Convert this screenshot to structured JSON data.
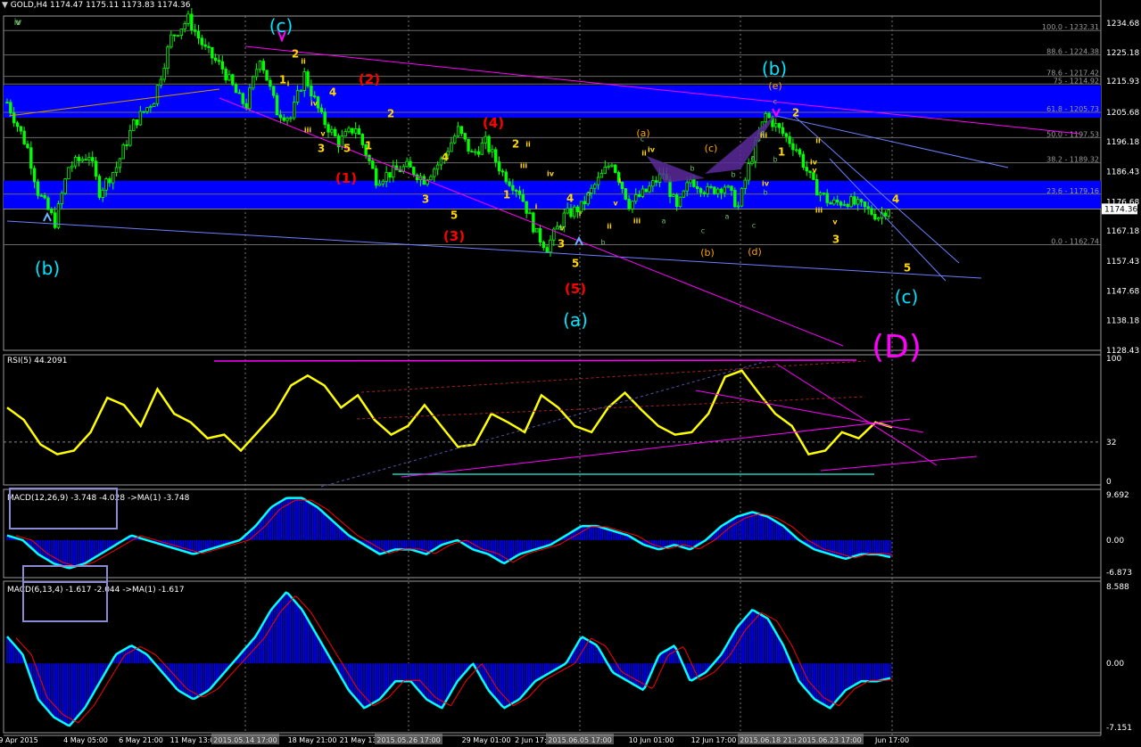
{
  "window": {
    "title": "GOLD,H4",
    "ohlc": "1174.47 1175.11 1173.83 1174.36"
  },
  "colors": {
    "background": "#000000",
    "bullCandle": "#00ff00",
    "bearCandle": "#00cc00",
    "zone": "#0000ff",
    "fib": "#6a6a6a",
    "magentaLine": "#ff00ff",
    "rsiLine": "#ffff00",
    "macdHist": "#0000ff",
    "macdMain": "#00ffff",
    "macdSignal": "#ff0000",
    "waveCyan": "#00e5ff",
    "waveRed": "#ff0000",
    "waveOrange": "#ffa500",
    "waveYellow": "#ffd700",
    "waveGreen": "#6fbf6f",
    "pinkD": "#ff00ff"
  },
  "chart_data": [
    {
      "type": "candlestick",
      "panel": "price",
      "symbol": "GOLD",
      "timeframe": "H4",
      "ylim": [
        1128.43,
        1237.0
      ],
      "yticks": [
        "1234.68",
        "1225.18",
        "1215.93",
        "1205.68",
        "1196.18",
        "1186.43",
        "1176.68",
        "1167.18",
        "1157.43",
        "1147.68",
        "1138.18",
        "1128.43"
      ],
      "current_price": "1174.36",
      "x_labels": [
        "29 Apr 2015",
        "4 May 05:00",
        "6 May 21:00",
        "11 May 13:00",
        "2015.05.14 17:00",
        "18 May 21:00",
        "21 May 13:00",
        "2015.05.26 17:00",
        "29 May 01:00",
        "2 Jun 17:00",
        "2015.06.05 17:00",
        "10 Jun 01:00",
        "12 Jun 17:00",
        "2015.06.18 21:00",
        "2015.06.23 17:00",
        "Jun 17:00"
      ],
      "path_points": [
        [
          0,
          1209
        ],
        [
          6,
          1194
        ],
        [
          9,
          1180
        ],
        [
          14,
          1170
        ],
        [
          18,
          1188
        ],
        [
          24,
          1192
        ],
        [
          27,
          1180
        ],
        [
          32,
          1188
        ],
        [
          37,
          1202
        ],
        [
          43,
          1210
        ],
        [
          48,
          1230
        ],
        [
          53,
          1236
        ],
        [
          58,
          1226
        ],
        [
          63,
          1220
        ],
        [
          68,
          1210
        ],
        [
          70,
          1208
        ],
        [
          74,
          1224
        ],
        [
          79,
          1206
        ],
        [
          83,
          1204
        ],
        [
          87,
          1218
        ],
        [
          92,
          1204
        ],
        [
          97,
          1196
        ],
        [
          102,
          1201
        ],
        [
          108,
          1184
        ],
        [
          112,
          1186
        ],
        [
          117,
          1188
        ],
        [
          122,
          1184
        ],
        [
          127,
          1190
        ],
        [
          132,
          1200
        ],
        [
          136,
          1192
        ],
        [
          140,
          1196
        ],
        [
          145,
          1186
        ],
        [
          150,
          1180
        ],
        [
          155,
          1166
        ],
        [
          158,
          1162
        ],
        [
          163,
          1172
        ],
        [
          168,
          1175
        ],
        [
          172,
          1182
        ],
        [
          177,
          1190
        ],
        [
          182,
          1176
        ],
        [
          187,
          1180
        ],
        [
          192,
          1186
        ],
        [
          196,
          1174
        ],
        [
          200,
          1184
        ],
        [
          205,
          1180
        ],
        [
          210,
          1182
        ],
        [
          214,
          1175
        ],
        [
          217,
          1188
        ],
        [
          222,
          1205
        ],
        [
          226,
          1200
        ],
        [
          231,
          1194
        ],
        [
          236,
          1182
        ],
        [
          241,
          1176
        ],
        [
          246,
          1177
        ],
        [
          250,
          1175
        ],
        [
          255,
          1172
        ],
        [
          259,
          1176
        ]
      ],
      "fib_levels": [
        {
          "label": "100.0 - 1232.31",
          "price": 1232.31
        },
        {
          "label": "88.6 - 1224.38",
          "price": 1224.38
        },
        {
          "label": "78.6 - 1217.42",
          "price": 1217.42
        },
        {
          "label": "75 - 1214.92",
          "price": 1214.92
        },
        {
          "label": "61.8 - 1205.73",
          "price": 1205.73
        },
        {
          "label": "50.0 - 1197.53",
          "price": 1197.53
        },
        {
          "label": "38.2 - 1189.32",
          "price": 1189.32
        },
        {
          "label": "23.6 - 1179.16",
          "price": 1179.16
        },
        {
          "label": "0.0 - 1162.74",
          "price": 1162.74
        }
      ],
      "zones": [
        {
          "from": 1204.0,
          "to": 1214.5
        },
        {
          "from": 1174.5,
          "to": 1183.5
        }
      ],
      "wave_labels": [
        {
          "text": "(c)",
          "color": "cyan",
          "big": true
        },
        {
          "text": "(b)",
          "color": "cyan",
          "big": true
        },
        {
          "text": "(a)",
          "color": "cyan",
          "big": true
        },
        {
          "text": "(b)",
          "color": "cyan",
          "big": true
        },
        {
          "text": "(c)",
          "color": "cyan",
          "big": true
        },
        {
          "text": "(D)",
          "color": "pink",
          "big": true
        },
        {
          "text": "(1)",
          "color": "red"
        },
        {
          "text": "(2)",
          "color": "red"
        },
        {
          "text": "(3)",
          "color": "red"
        },
        {
          "text": "(4)",
          "color": "red"
        },
        {
          "text": "(5)",
          "color": "red"
        },
        {
          "text": "(a)",
          "color": "orange"
        },
        {
          "text": "(b)",
          "color": "orange"
        },
        {
          "text": "(c)",
          "color": "orange"
        },
        {
          "text": "(d)",
          "color": "orange"
        },
        {
          "text": "(e)",
          "color": "orange"
        },
        {
          "text": "1",
          "color": "yellow"
        },
        {
          "text": "2",
          "color": "yellow"
        },
        {
          "text": "3",
          "color": "yellow"
        },
        {
          "text": "4",
          "color": "yellow"
        },
        {
          "text": "5",
          "color": "yellow"
        },
        {
          "text": "1",
          "color": "yellow"
        },
        {
          "text": "2",
          "color": "yellow"
        },
        {
          "text": "3",
          "color": "yellow"
        },
        {
          "text": "4",
          "color": "yellow"
        },
        {
          "text": "5",
          "color": "yellow"
        },
        {
          "text": "1",
          "color": "yellow"
        },
        {
          "text": "2",
          "color": "yellow"
        },
        {
          "text": "3",
          "color": "yellow"
        },
        {
          "text": "4",
          "color": "yellow"
        },
        {
          "text": "5",
          "color": "yellow"
        },
        {
          "text": "1",
          "color": "yellow"
        },
        {
          "text": "2",
          "color": "yellow"
        },
        {
          "text": "3",
          "color": "yellow"
        },
        {
          "text": "4",
          "color": "yellow"
        },
        {
          "text": "5",
          "color": "yellow"
        },
        {
          "text": "i",
          "color": "yellow"
        },
        {
          "text": "ii",
          "color": "yellow"
        },
        {
          "text": "iii",
          "color": "yellow"
        },
        {
          "text": "iv",
          "color": "yellow"
        },
        {
          "text": "v",
          "color": "yellow"
        },
        {
          "text": "i",
          "color": "yellow"
        },
        {
          "text": "ii",
          "color": "yellow"
        },
        {
          "text": "iii",
          "color": "yellow"
        },
        {
          "text": "iv",
          "color": "yellow"
        },
        {
          "text": "v",
          "color": "yellow"
        },
        {
          "text": "i",
          "color": "yellow"
        },
        {
          "text": "ii",
          "color": "yellow"
        },
        {
          "text": "iii",
          "color": "yellow"
        },
        {
          "text": "iv",
          "color": "yellow"
        },
        {
          "text": "v",
          "color": "yellow"
        },
        {
          "text": "ii",
          "color": "yellow"
        },
        {
          "text": "iii",
          "color": "yellow"
        },
        {
          "text": "iv",
          "color": "yellow"
        },
        {
          "text": "v",
          "color": "yellow"
        },
        {
          "text": "i",
          "color": "yellow"
        },
        {
          "text": "ii",
          "color": "yellow"
        },
        {
          "text": "iii",
          "color": "yellow"
        },
        {
          "text": "iv",
          "color": "yellow"
        },
        {
          "text": "v",
          "color": "yellow"
        },
        {
          "text": "a",
          "color": "green"
        },
        {
          "text": "b",
          "color": "green"
        },
        {
          "text": "c",
          "color": "green"
        },
        {
          "text": "a",
          "color": "green"
        },
        {
          "text": "b",
          "color": "green"
        },
        {
          "text": "c",
          "color": "green"
        },
        {
          "text": "a",
          "color": "green"
        },
        {
          "text": "b",
          "color": "green"
        },
        {
          "text": "c",
          "color": "green"
        },
        {
          "text": "a",
          "color": "green"
        },
        {
          "text": "b",
          "color": "green"
        },
        {
          "text": "c",
          "color": "green"
        },
        {
          "text": "a",
          "color": "green"
        },
        {
          "text": "b",
          "color": "green"
        },
        {
          "text": "c",
          "color": "green"
        },
        {
          "text": "v",
          "color": "green"
        },
        {
          "text": "v",
          "color": "green"
        },
        {
          "text": "iv",
          "color": "green"
        }
      ]
    },
    {
      "type": "line",
      "panel": "rsi",
      "title": "RSI(5) 44.2091",
      "ylim": [
        0,
        100
      ],
      "yticks": [
        "100",
        "32",
        "0"
      ],
      "reference_level": 32,
      "values": [
        60,
        50,
        30,
        22,
        25,
        40,
        68,
        62,
        45,
        75,
        55,
        48,
        35,
        38,
        25,
        40,
        55,
        78,
        86,
        78,
        60,
        70,
        50,
        38,
        45,
        62,
        45,
        28,
        30,
        55,
        48,
        40,
        70,
        60,
        45,
        40,
        60,
        72,
        58,
        45,
        38,
        40,
        55,
        85,
        90,
        72,
        55,
        45,
        22,
        25,
        40,
        35,
        48,
        44
      ]
    },
    {
      "type": "bar+line",
      "panel": "macd1",
      "title": "MACD(12,26,9) -3.748 -4.028 ->MA(1) -3.748",
      "ylim": [
        -6.873,
        9.692
      ],
      "yticks": [
        "9.692",
        "0.00",
        "-6.873"
      ],
      "values": [
        1,
        0,
        -3,
        -5,
        -6,
        -5,
        -3,
        -1,
        1,
        0,
        -1,
        -2,
        -3,
        -2,
        -1,
        0,
        3,
        7,
        9,
        9,
        7,
        4,
        1,
        -1,
        -3,
        -2,
        -2,
        -3,
        -1,
        0,
        -2,
        -3,
        -5,
        -3,
        -2,
        -1,
        1,
        3,
        3,
        2,
        1,
        -1,
        -2,
        -1,
        -2,
        0,
        3,
        5,
        6,
        5,
        3,
        0,
        -2,
        -3,
        -4,
        -3,
        -3,
        -3.7
      ]
    },
    {
      "type": "bar+line",
      "panel": "macd2",
      "title": "MACD(6,13,4) -1.617 -2.044 ->MA(1) -1.617",
      "ylim": [
        -7.151,
        8.588
      ],
      "yticks": [
        "8.588",
        "0.00",
        "-7.151"
      ],
      "values": [
        3,
        1,
        -4,
        -6,
        -7,
        -5,
        -2,
        1,
        2,
        1,
        -1,
        -3,
        -4,
        -3,
        -1,
        1,
        3,
        6,
        8,
        6,
        3,
        0,
        -3,
        -5,
        -4,
        -2,
        -2,
        -4,
        -5,
        -2,
        0,
        -3,
        -5,
        -4,
        -2,
        -1,
        0,
        3,
        2,
        -1,
        -2,
        -3,
        1,
        2,
        -2,
        -1,
        1,
        4,
        6,
        5,
        2,
        -2,
        -4,
        -5,
        -3,
        -2,
        -2,
        -1.6
      ]
    }
  ]
}
